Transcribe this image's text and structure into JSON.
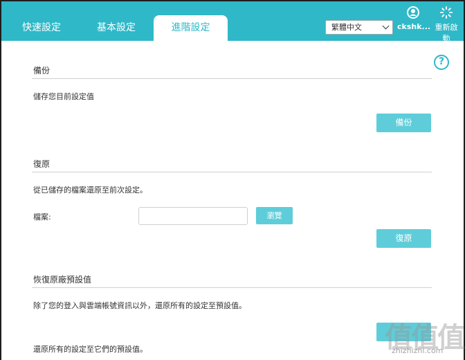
{
  "tabs": [
    {
      "label": "快速設定",
      "active": false
    },
    {
      "label": "基本設定",
      "active": false
    },
    {
      "label": "進階設定",
      "active": true
    }
  ],
  "language": {
    "selected": "繁體中文"
  },
  "header": {
    "user_label": "ckshk...",
    "reboot_label_1": "重新啟",
    "reboot_label_2": "動"
  },
  "backup": {
    "title": "備份",
    "description": "儲存您目前設定值",
    "button": "備份"
  },
  "restore": {
    "title": "復原",
    "description": "從已儲存的檔案還原至前次設定。",
    "file_label": "檔案:",
    "browse_button": "瀏覽",
    "button": "復原"
  },
  "factory": {
    "title": "恢復原廠預設值",
    "description": "除了您的登入與雲端帳號資訊以外，還原所有的設定至預設值。",
    "description2": "還原所有的設定至它們的預設值。"
  },
  "watermark": {
    "text": "值值值",
    "sub": "zhizhizhi.com"
  },
  "colors": {
    "accent": "#2fb8c8",
    "button": "#5fcdd9"
  }
}
